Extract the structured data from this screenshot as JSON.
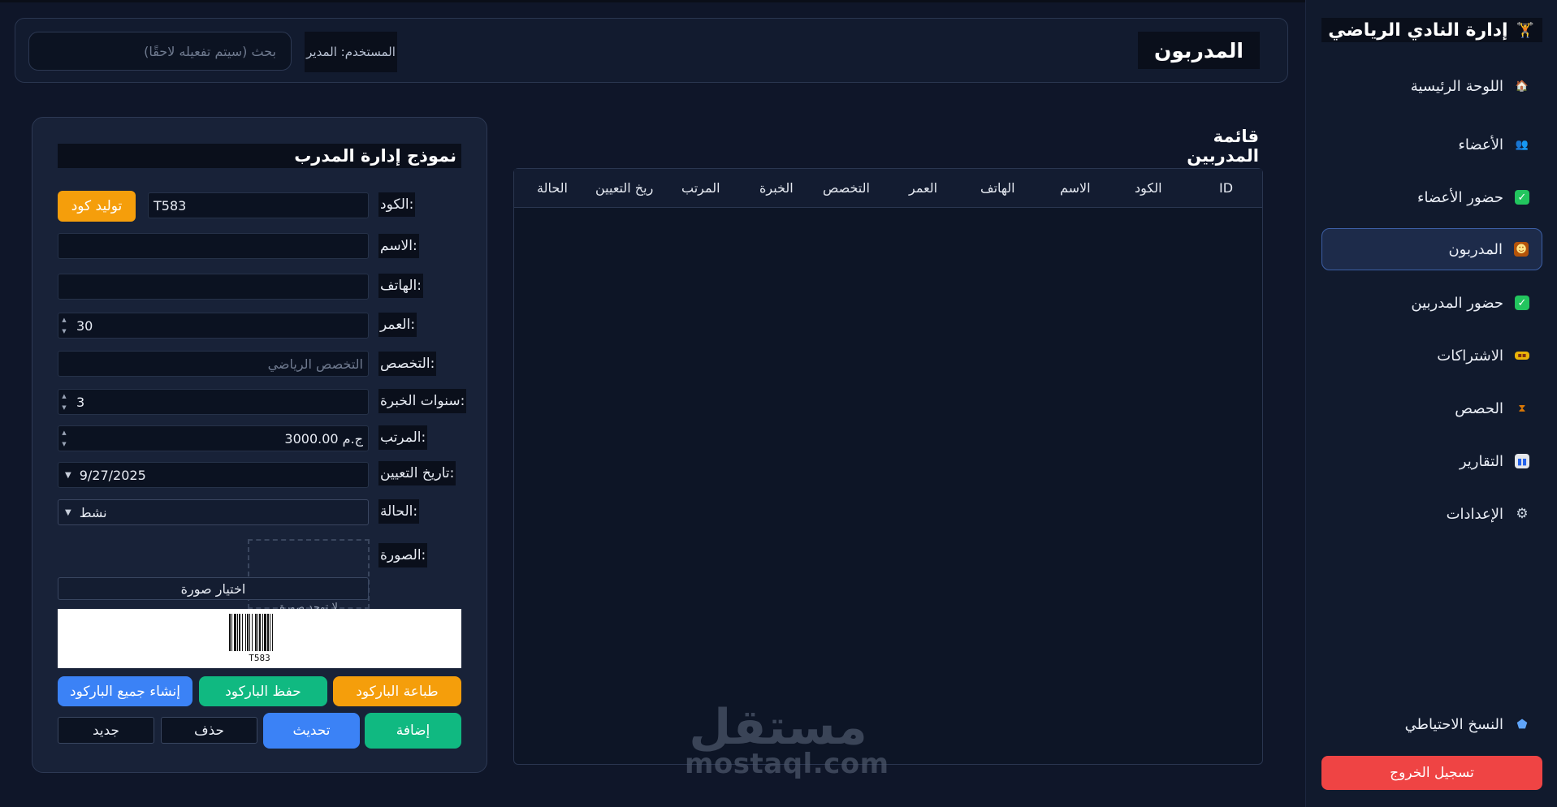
{
  "sidebar": {
    "brand": "إدارة النادي الرياضي",
    "brand_icon": "dumbbell-icon",
    "items": [
      {
        "label": "اللوحة الرئيسية",
        "icon": "home-icon"
      },
      {
        "label": "الأعضاء",
        "icon": "users-icon"
      },
      {
        "label": "حضور الأعضاء",
        "icon": "check-icon"
      },
      {
        "label": "المدربون",
        "icon": "trainer-icon",
        "active": true
      },
      {
        "label": "حضور المدربين",
        "icon": "check-icon"
      },
      {
        "label": "الاشتراكات",
        "icon": "ticket-icon"
      },
      {
        "label": "الحصص",
        "icon": "dumbbell-icon"
      },
      {
        "label": "التقارير",
        "icon": "chart-icon"
      },
      {
        "label": "الإعدادات",
        "icon": "gear-icon"
      }
    ],
    "backup": {
      "label": "النسخ الاحتياطي",
      "icon": "shield-icon"
    },
    "logout": "تسجيل الخروج"
  },
  "header": {
    "title": "المدربون",
    "user": "المستخدم: المدير",
    "search_placeholder": "بحث (سيتم تفعيله لاحقًا)"
  },
  "list": {
    "title": "قائمة المدربين",
    "columns": [
      "ID",
      "الكود",
      "الاسم",
      "الهاتف",
      "العمر",
      "التخصص",
      "الخبرة",
      "المرتب",
      "ريخ التعيين",
      "الحالة"
    ],
    "rows": []
  },
  "form": {
    "title": "نموذج إدارة المدرب",
    "code_label": "الكود:",
    "code_value": "T583",
    "generate_code": "توليد كود",
    "name_label": "الاسم:",
    "name_value": "",
    "phone_label": "الهاتف:",
    "phone_value": "",
    "age_label": "العمر:",
    "age_value": "30",
    "specialty_label": "التخصص:",
    "specialty_placeholder": "التخصص الرياضي",
    "experience_label": "سنوات الخبرة:",
    "experience_value": "3",
    "salary_label": "المرتب:",
    "salary_value": "3000.00 ج.م",
    "hire_date_label": "تاريخ التعيين:",
    "hire_date_value": "9/27/2025",
    "status_label": "الحالة:",
    "status_value": "نشط",
    "photo_label": "الصورة:",
    "photo_placeholder": "لا توجد صورة",
    "choose_photo": "اختيار صورة",
    "barcode_text": "T583",
    "print_barcode": "طباعة الباركود",
    "save_barcode": "حفظ الباركود",
    "generate_all_barcodes": "إنشاء جميع الباركود",
    "add": "إضافة",
    "update": "تحديث",
    "delete": "حذف",
    "new": "جديد"
  },
  "watermark": {
    "arabic": "مستقل",
    "latin": "mostaql.com"
  },
  "colors": {
    "background": "#0f1629",
    "panel": "#182238",
    "orange": "#f59e0b",
    "green": "#10b981",
    "blue": "#3b82f6",
    "red": "#ef4444"
  }
}
